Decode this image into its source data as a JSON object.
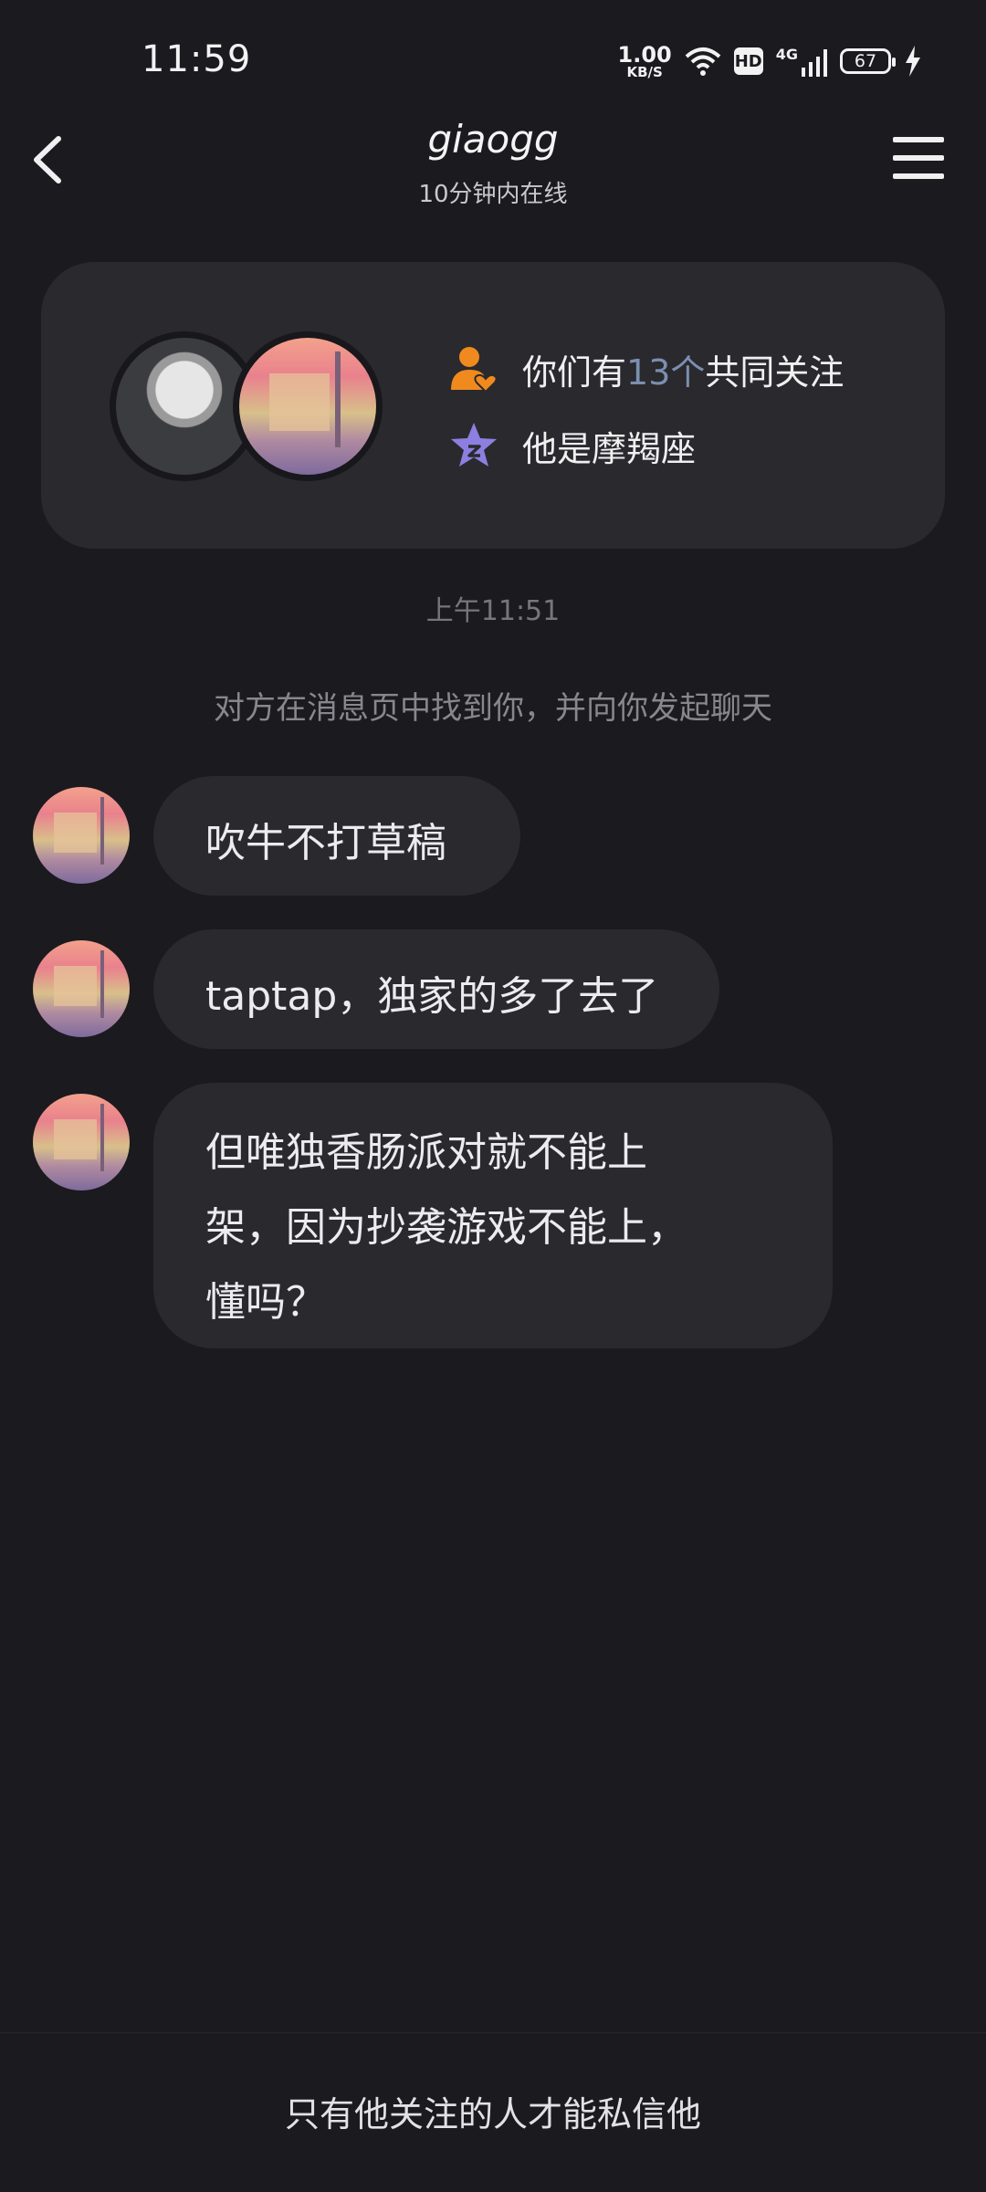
{
  "status_bar": {
    "time": "11:59",
    "net_speed_value": "1.00",
    "net_speed_unit": "KB/S",
    "hd_label": "HD",
    "network_type": "4G",
    "battery_level": "67"
  },
  "header": {
    "title": "giaogg",
    "subtitle": "10分钟内在线"
  },
  "info_card": {
    "mutual_prefix": "你们有",
    "mutual_count": "13个",
    "mutual_suffix": "共同关注",
    "zodiac": "他是摩羯座"
  },
  "chat": {
    "timestamp": "上午11:51",
    "system_message": "对方在消息页中找到你，并向你发起聊天",
    "messages": [
      {
        "text": "吹牛不打草稿"
      },
      {
        "text": "taptap，独家的多了去了"
      },
      {
        "text": "但唯独香肠派对就不能上\n架，因为抄袭游戏不能上，\n懂吗？"
      }
    ]
  },
  "footer": {
    "notice": "只有他关注的人才能私信他"
  },
  "colors": {
    "background": "#1b1a1f",
    "card": "#2a292e",
    "highlight": "#7b8fb0",
    "person_icon": "#f08a1e",
    "star_icon": "#8c7fe0"
  }
}
